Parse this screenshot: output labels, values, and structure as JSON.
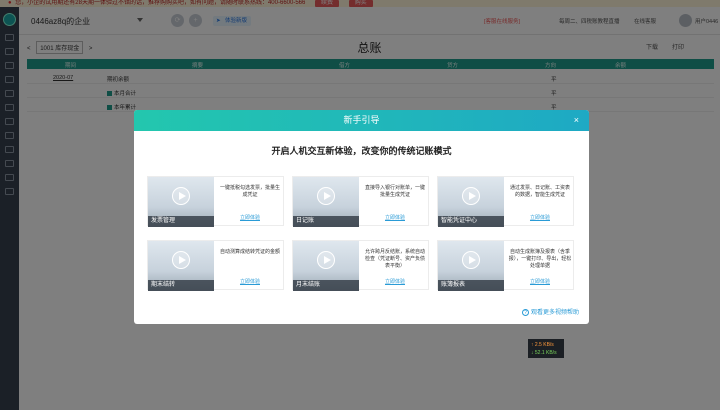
{
  "notice": {
    "text": "您，小企的试用期还有28天期一体验过不错的话，推荐购购买吧，如有问题，请随时联系热线：400-6600-566",
    "btn1": "续费",
    "btn2": "购买"
  },
  "header": {
    "company": "0446az8q的企业",
    "new_tag": "体验新版",
    "service": "[客服在线服务]",
    "live": "每周二、四税账教程直播",
    "online": "在线客服",
    "user": "用户0446"
  },
  "content": {
    "period_prefix": "<",
    "period": "1001 库存现金",
    "period_suffix": ">",
    "title": "总账",
    "download": "下载",
    "print": "打印",
    "columns": [
      "期间",
      "摘要",
      "借方",
      "贷方",
      "方向",
      "余额"
    ],
    "rows": [
      {
        "period": "2020-07",
        "summary": "期初余额",
        "debit": "",
        "credit": "",
        "direction": "平",
        "balance": ""
      },
      {
        "period": "",
        "summary": "本月合计",
        "debit": "",
        "credit": "",
        "direction": "平",
        "balance": ""
      },
      {
        "period": "",
        "summary": "本年累计",
        "debit": "",
        "credit": "",
        "direction": "平",
        "balance": ""
      }
    ]
  },
  "modal": {
    "title": "新手引导",
    "close": "×",
    "subtitle": "开启人机交互新体验，改变你的传统记账模式",
    "cards": [
      {
        "name": "发票管理",
        "desc": "一键抵税勾选发票，批量生成凭证",
        "link": "立即体验"
      },
      {
        "name": "日记账",
        "desc": "直接导入银行对账单，一键批量生成凭证",
        "link": "立即体验"
      },
      {
        "name": "智能凭证中心",
        "desc": "通过发票、日记账、工资表的数据，智能生成凭证",
        "link": "立即体验"
      },
      {
        "name": "期末结转",
        "desc": "自动测算成结转凭证的金额",
        "link": "立即体验"
      },
      {
        "name": "月末结账",
        "desc": "允许跨月反结账，系统自动检查（凭证断号、资产负债表平衡）",
        "link": "立即体验"
      },
      {
        "name": "账簿报表",
        "desc": "自动生成账簿及报表（含季报），一键打印、导出，轻松处理单据",
        "link": "立即体验"
      }
    ],
    "more": "观看更多视频帮助"
  },
  "speed": {
    "up": "↑ 2.5 KB/s",
    "down": "↓ 52.1 KB/s"
  }
}
